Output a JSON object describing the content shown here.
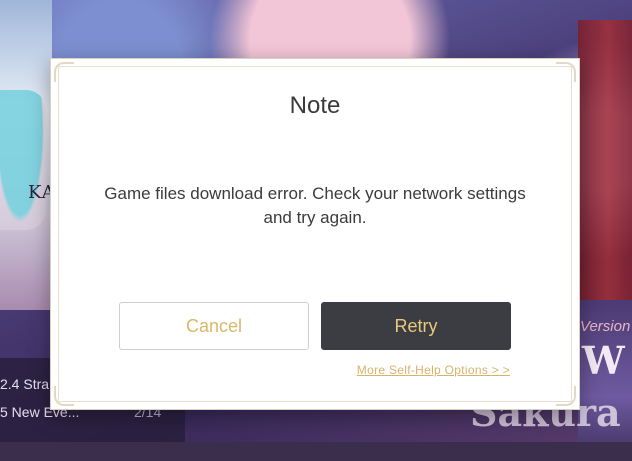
{
  "background": {
    "left_glyph": "KA",
    "news": [
      {
        "title": "2.4 Stra",
        "date": ""
      },
      {
        "title": "5 New Eve...",
        "date": "2/14"
      }
    ],
    "banner_version_text": "Version",
    "banner_big_text": "W",
    "banner_sakura_text": "Sakura"
  },
  "dialog": {
    "title": "Note",
    "message": "Game files download error. Check your network settings and try again.",
    "cancel_label": "Cancel",
    "retry_label": "Retry",
    "help_link": "More Self-Help Options > >"
  },
  "colors": {
    "accent_gold": "#d8b96a",
    "retry_bg": "#3b3d42",
    "frame": "#e2d9c4"
  }
}
